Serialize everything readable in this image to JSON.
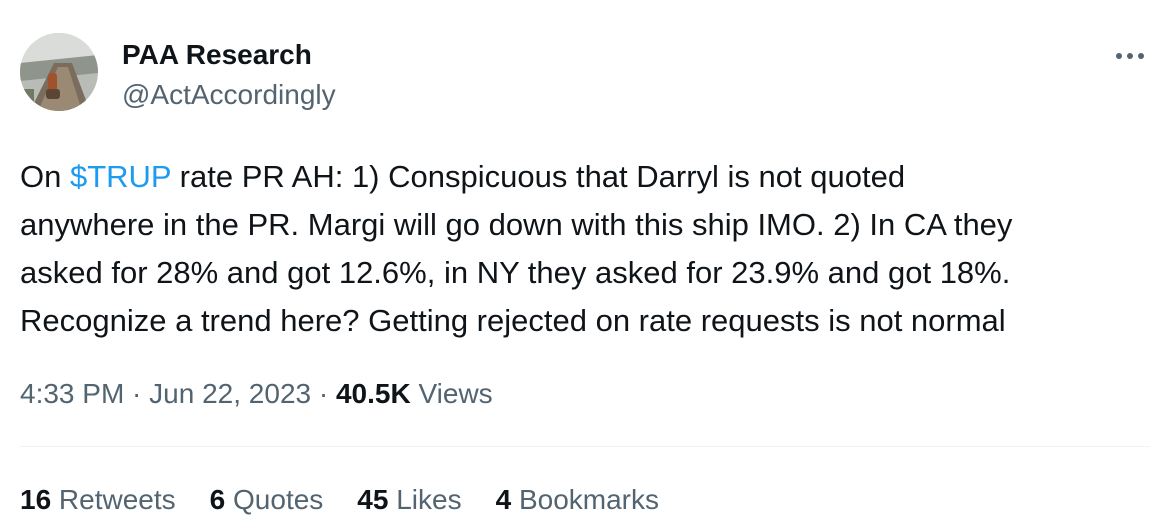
{
  "author": {
    "display_name": "PAA Research",
    "handle": "@ActAccordingly",
    "avatar_icon": "avatar-photo-boardwalk"
  },
  "more_icon": "more-horizontal-icon",
  "tweet": {
    "lines": [
      {
        "prefix": "On ",
        "cashtag": "$TRUP",
        "suffix": " rate PR AH: 1) Conspicuous that Darryl is not quoted"
      },
      {
        "text": "anywhere in the PR. Margi will go down with this ship IMO.  2) In CA they"
      },
      {
        "text": "asked for 28% and got 12.6%, in NY they asked for 23.9% and got 18%."
      },
      {
        "text": "Recognize a trend here? Getting rejected on rate requests is not normal"
      }
    ]
  },
  "meta": {
    "time": "4:33 PM",
    "separator": " · ",
    "date": "Jun 22, 2023",
    "views_count": "40.5K",
    "views_label": " Views"
  },
  "stats": {
    "retweets": {
      "count": "16",
      "label": " Retweets"
    },
    "quotes": {
      "count": "6",
      "label": " Quotes"
    },
    "likes": {
      "count": "45",
      "label": " Likes"
    },
    "bookmarks": {
      "count": "4",
      "label": " Bookmarks"
    }
  },
  "colors": {
    "link": "#1d9bf0",
    "primary_text": "#0f1419",
    "secondary_text": "#536471",
    "divider": "#eff3f4"
  }
}
